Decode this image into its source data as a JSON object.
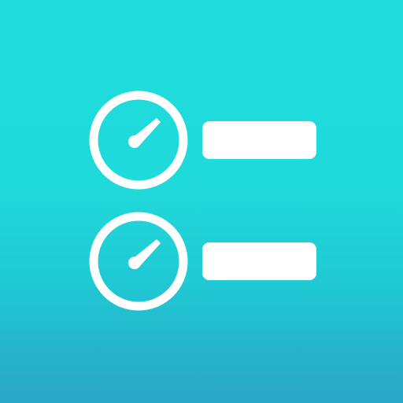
{
  "app": {
    "icon_name": "speed-dial-list-icon",
    "background_top": "#1fdcdc",
    "background_bottom": "#2aa6c6",
    "foreground": "#ffffff"
  },
  "rows": [
    {
      "icon": "gauge-icon",
      "placeholder": "bar"
    },
    {
      "icon": "gauge-icon",
      "placeholder": "bar"
    }
  ]
}
